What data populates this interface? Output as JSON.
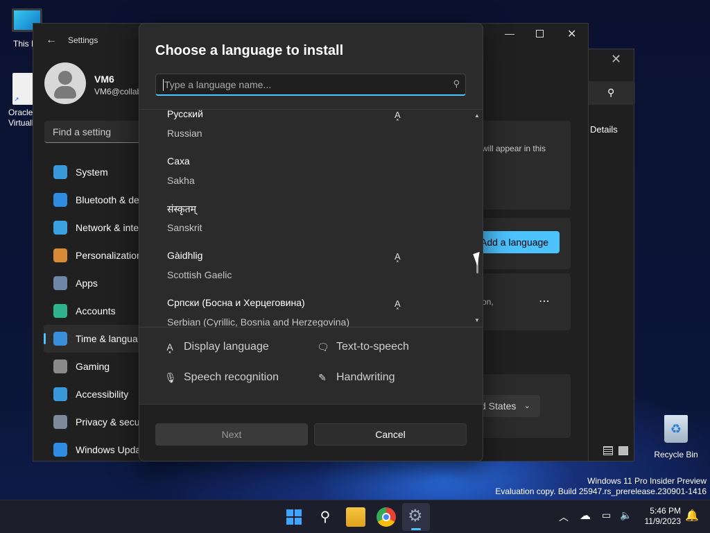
{
  "desktop": {
    "icons": [
      {
        "label": "This P"
      },
      {
        "label": "Oracle\nVirtuall"
      },
      {
        "label": "Recycle Bin"
      }
    ],
    "watermark": {
      "line1": "Windows 11 Pro Insider Preview",
      "line2": "Evaluation copy. Build 25947.rs_prerelease.230901-1416"
    }
  },
  "settings": {
    "title": "Settings",
    "user": {
      "name": "VM6",
      "email": "VM6@collab"
    },
    "search_placeholder": "Find a setting",
    "nav": [
      {
        "label": "System",
        "color": "#3a9ad9"
      },
      {
        "label": "Bluetooth & de",
        "color": "#2f8be0"
      },
      {
        "label": "Network & inte",
        "color": "#3aa0e0"
      },
      {
        "label": "Personalization",
        "color": "#d98b3a"
      },
      {
        "label": "Apps",
        "color": "#6f86a8"
      },
      {
        "label": "Accounts",
        "color": "#2fb38a"
      },
      {
        "label": "Time & langua",
        "color": "#3a8fd9"
      },
      {
        "label": "Gaming",
        "color": "#8a8a8a"
      },
      {
        "label": "Accessibility",
        "color": "#3a9ad9"
      },
      {
        "label": "Privacy & secu",
        "color": "#7d8a99"
      },
      {
        "label": "Windows Upda",
        "color": "#2f8be0"
      }
    ],
    "right": {
      "will_appear": "will appear in this",
      "add_language": "Add a language",
      "on_text": "on,",
      "more": "⋯",
      "region_value": "d States",
      "details": "Details"
    }
  },
  "dialog": {
    "title": "Choose a language to install",
    "search_placeholder": "Type a language name...",
    "languages": [
      {
        "native": "Русский",
        "english": "Russian",
        "has_display": true
      },
      {
        "native": "Саха",
        "english": "Sakha",
        "has_display": false
      },
      {
        "native": "संस्कृतम्",
        "english": "Sanskrit",
        "has_display": false
      },
      {
        "native": "Gàidhlig",
        "english": "Scottish Gaelic",
        "has_display": true
      },
      {
        "native": "Српски (Босна и Херцеговина)",
        "english": "Serbian (Cyrillic, Bosnia and Herzegovina)",
        "has_display": true
      }
    ],
    "legend": {
      "display": "Display language",
      "tts": "Text-to-speech",
      "speech": "Speech recognition",
      "handwriting": "Handwriting"
    },
    "buttons": {
      "next": "Next",
      "cancel": "Cancel"
    }
  },
  "taskbar": {
    "time": "5:46 PM",
    "date": "11/9/2023"
  }
}
